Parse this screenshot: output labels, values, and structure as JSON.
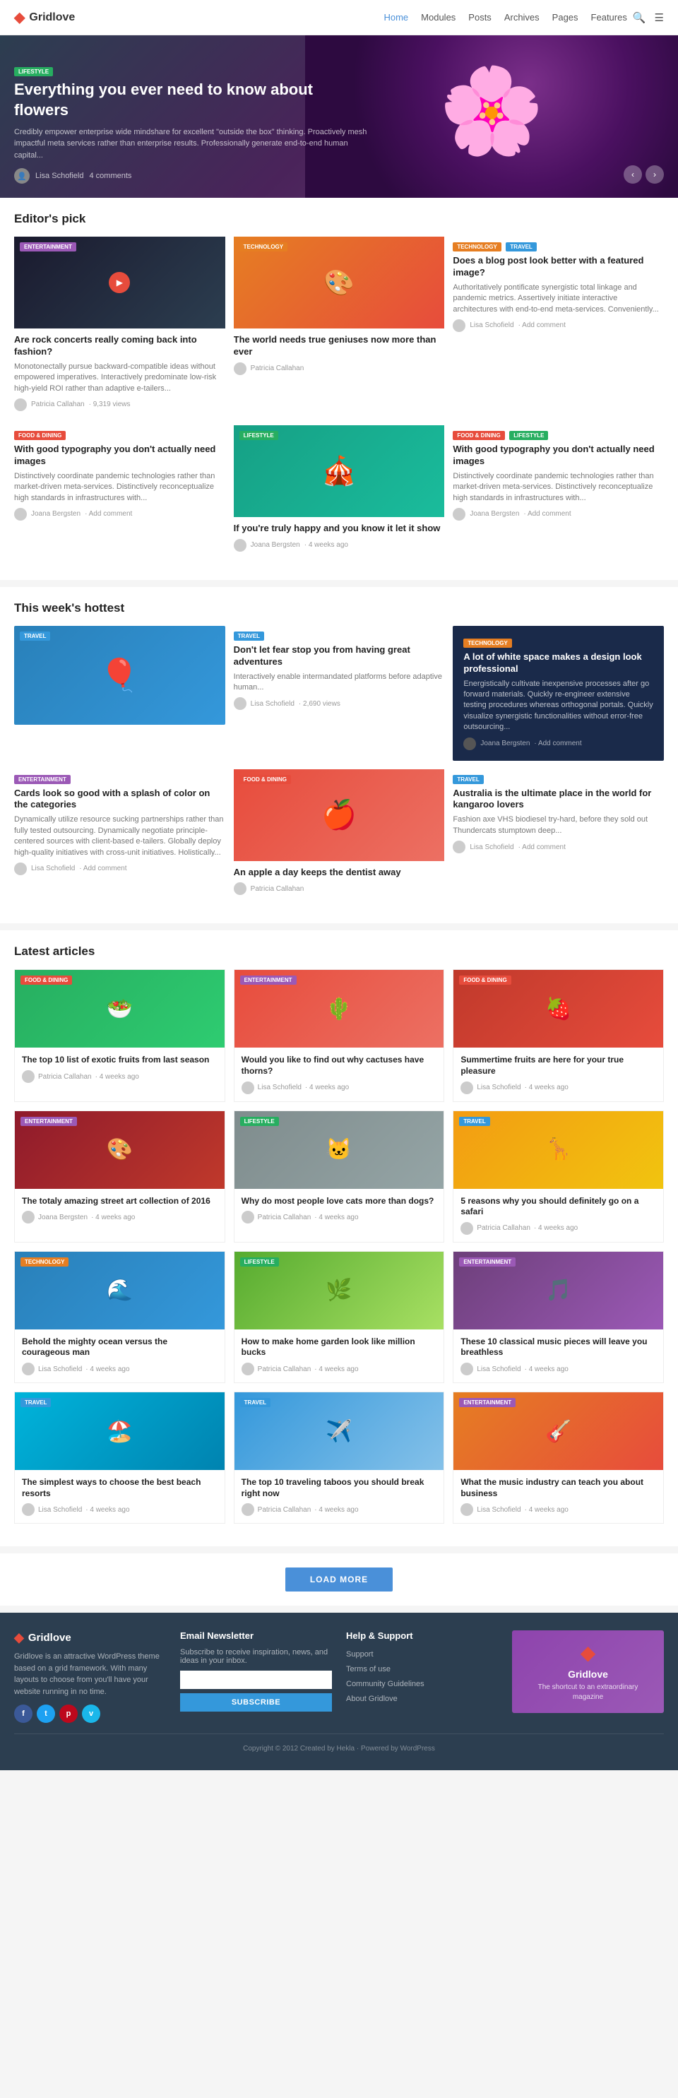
{
  "site": {
    "name": "Gridlove",
    "tagline": "The shortcut to an extraordinary magazine"
  },
  "nav": {
    "items": [
      "Home",
      "Modules",
      "Posts",
      "Archives",
      "Pages",
      "Features"
    ],
    "active": "Home"
  },
  "hero": {
    "badge": "LIFESTYLE",
    "title": "Everything you ever need to know about flowers",
    "description": "Credibly empower enterprise wide mindshare for excellent \"outside the box\" thinking. Proactively mesh impactful meta services rather than enterprise results. Professionally generate end-to-end human capital...",
    "author": "Lisa Schofield",
    "comments": "4 comments"
  },
  "editors_pick": {
    "section_title": "Editor's pick",
    "cards": [
      {
        "badge": "ENTERTAINMENT",
        "badge_class": "badge-ent",
        "title": "Are rock concerts really coming back into fashion?",
        "description": "Monotonectally pursue backward-compatible ideas without empowered imperatives. Interactively predominate low-risk high-yield ROI rather than adaptive e-tailers...",
        "author": "Patricia Callahan",
        "views": "9,319 views",
        "has_play": true
      },
      {
        "badge": "TECHNOLOGY",
        "badge_class": "badge-tech",
        "title": "The world needs true geniuses now more than ever",
        "author": "Patricia Callahan",
        "has_image": true
      },
      {
        "badge": "TECHNOLOGY",
        "badge_class": "badge-tech",
        "title": "Does a blog post look better with a featured image?",
        "description": "Authoritatively pontificate synergistic total linkage and pandemic metrics. Assertively initiate interactive architectures with end-to-end meta-services. Conveniently...",
        "author": "Lisa Schofield",
        "has_add_comment": true
      },
      {
        "badge": "LIFESTYLE",
        "badge_class": "badge-lifestyle",
        "title": "If you're truly happy and you know it let it show",
        "author": "Joana Bergsten",
        "time": "4 weeks ago",
        "has_image": true
      },
      {
        "badge_list": [
          "FOOD & DINING"
        ],
        "badge_class": "badge-food",
        "title": "With good typography you don't actually need images",
        "description": "Distinctively coordinate pandemic technologies rather than market-driven meta-services. Distinctively reconceptualize high standards in infrastructures with...",
        "author": "Joana Bergsten",
        "has_add_comment": true
      }
    ]
  },
  "this_week": {
    "section_title": "This week's hottest",
    "cards": [
      {
        "title": "Don't let fear stop you from having great adventures",
        "description": "Interactively enable intermandated platforms before adaptive human...",
        "author": "Lisa Schofield",
        "views": "2,690 views",
        "badge": "TRAVEL",
        "badge_class": "badge-travel"
      },
      {
        "title": "A lot of white space makes a design look professional",
        "description": "Energistically cultivate inexpensive processes after go forward materials. Quickly re-engineer extensive testing procedures whereas orthogonal portals. Quickly visualize synergistic functionalities without error-free outsourcing...",
        "author": "Joana Bergsten",
        "has_add_comment": true,
        "badge": "TECHNOLOGY",
        "badge_class": "badge-tech",
        "is_dark": true
      },
      {
        "title": "Cards look so good with a splash of color on the categories",
        "description": "Dynamically utilize resource sucking partnerships rather than fully tested outsourcing. Dynamically negotiate principle-centered sources with client-based e-tailers. Globally deploy high-quality initiatives with cross-unit initiatives. Holistically...",
        "author": "Lisa Schofield",
        "has_add_comment": true,
        "badge": "ENTERTAINMENT",
        "badge_class": "badge-ent"
      },
      {
        "title": "An apple a day keeps the dentist away",
        "author": "Patricia Callahan",
        "badge": "FOOD & DINING",
        "badge_class": "badge-food",
        "has_image": true
      },
      {
        "title": "Australia is the ultimate place in the world for kangaroo lovers",
        "description": "Fashion axe VHS biodiesel try-hard, before they sold out Thundercats stumptown deep...",
        "author": "Lisa Schofield",
        "has_add_comment": true,
        "badge": "TRAVEL",
        "badge_class": "badge-travel"
      }
    ]
  },
  "latest_articles": {
    "section_title": "Latest articles",
    "cards": [
      {
        "title": "The top 10 list of exotic fruits from last season",
        "author": "Patricia Callahan",
        "time": "4 weeks ago",
        "badge": "FOOD & DINING",
        "badge_class": "badge-food",
        "img_class": "img-green"
      },
      {
        "title": "Would you like to find out why cactuses have thorns?",
        "author": "Lisa Schofield",
        "time": "4 weeks ago",
        "badge": "ENTERTAINMENT",
        "badge_class": "badge-ent",
        "img_class": "img-salmon"
      },
      {
        "title": "Summertime fruits are here for your true pleasure",
        "author": "Lisa Schofield",
        "time": "4 weeks ago",
        "badge": "FOOD & DINING",
        "badge_class": "badge-food",
        "img_class": "img-red"
      },
      {
        "title": "The totaly amazing street art collection of 2016",
        "author": "Joana Bergsten",
        "time": "4 weeks ago",
        "badge": "ENTERTAINMENT",
        "badge_class": "badge-ent",
        "img_class": "img-darkred",
        "is_dark": true
      },
      {
        "title": "Why do most people love cats more than dogs?",
        "author": "Patricia Callahan",
        "time": "4 weeks ago",
        "badge": "LIFESTYLE",
        "badge_class": "badge-lifestyle",
        "img_class": "img-gray"
      },
      {
        "title": "5 reasons why you should definitely go on a safari",
        "author": "Patricia Callahan",
        "time": "4 weeks ago",
        "badge": "TRAVEL",
        "badge_class": "badge-travel",
        "img_class": "img-yellow"
      },
      {
        "title": "Behold the mighty ocean versus the courageous man",
        "author": "Lisa Schofield",
        "time": "4 weeks ago",
        "badge": "TECHNOLOGY",
        "badge_class": "badge-tech",
        "img_class": "img-blue"
      },
      {
        "title": "How to make home garden look like million bucks",
        "author": "Patricia Callahan",
        "time": "4 weeks ago",
        "badge": "LIFESTYLE",
        "badge_class": "badge-lifestyle",
        "img_class": "img-lime"
      },
      {
        "title": "These 10 classical music pieces will leave you breathless",
        "author": "Lisa Schofield",
        "time": "4 weeks ago",
        "badge": "ENTERTAINMENT",
        "badge_class": "badge-ent",
        "img_class": "img-purple"
      },
      {
        "title": "The simplest ways to choose the best beach resorts",
        "author": "Lisa Schofield",
        "time": "4 weeks ago",
        "badge": "TRAVEL",
        "badge_class": "badge-travel",
        "img_class": "img-aqua"
      },
      {
        "title": "The top 10 traveling taboos you should break right now",
        "author": "Patricia Callahan",
        "time": "4 weeks ago",
        "badge": "TRAVEL",
        "badge_class": "badge-travel",
        "img_class": "img-lightblue"
      },
      {
        "title": "What the music industry can teach you about business",
        "author": "Lisa Schofield",
        "time": "4 weeks ago",
        "badge": "ENTERTAINMENT",
        "badge_class": "badge-ent",
        "img_class": "img-orange"
      }
    ]
  },
  "load_more": "LOAD MORE",
  "footer": {
    "about_text": "Gridlove is an attractive WordPress theme based on a grid framework. With many layouts to choose from you'll have your website running in no time.",
    "social": [
      "f",
      "t",
      "p",
      "v"
    ],
    "newsletter": {
      "title": "Email Newsletter",
      "description": "Subscribe to receive inspiration, news, and ideas in your inbox.",
      "placeholder": "",
      "button": "SUBSCRIBE"
    },
    "help": {
      "title": "Help & Support",
      "links": [
        "Support",
        "Terms of use",
        "Community Guidelines",
        "About Gridlove"
      ]
    },
    "brand": {
      "tagline": "The shortcut to an extraordinary magazine"
    },
    "copyright": "Copyright © 2012 Created by Hekla · Powered by WordPress"
  }
}
